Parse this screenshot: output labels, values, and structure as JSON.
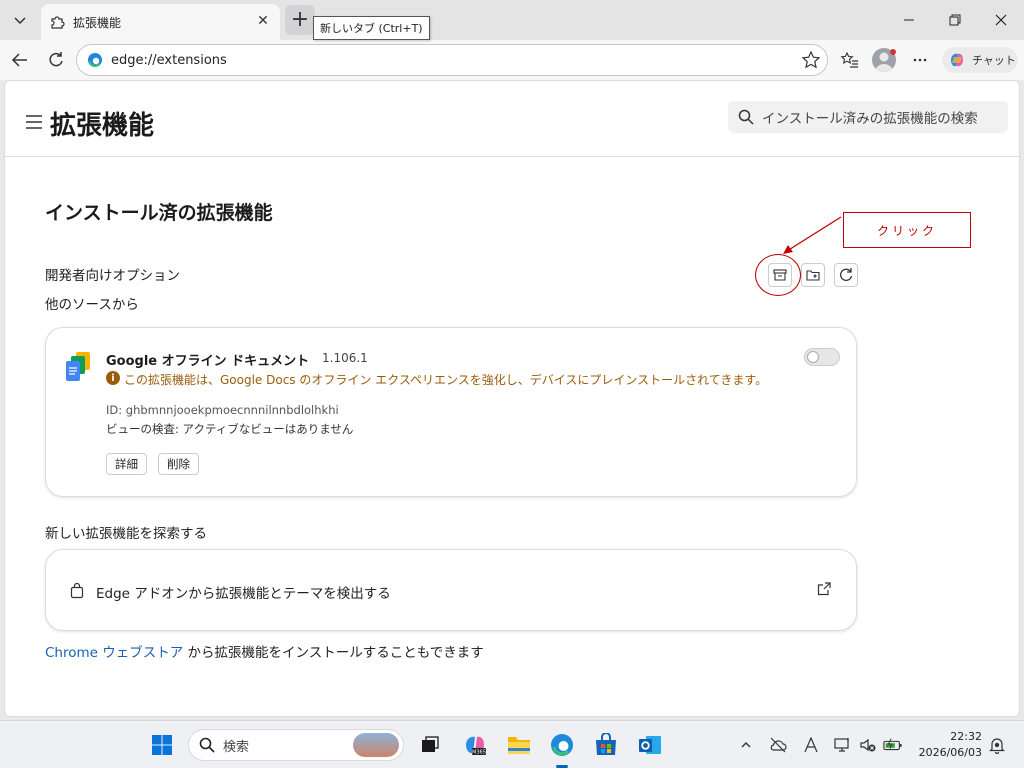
{
  "browser": {
    "tab_title": "拡張機能",
    "tab_close": "✕",
    "new_tab_tooltip": "新しいタブ (Ctrl+T)",
    "address": "edge://extensions",
    "chat_label": "チャット"
  },
  "page": {
    "title": "拡張機能",
    "search_placeholder": "インストール済みの拡張機能の検索",
    "section_title": "インストール済の拡張機能",
    "dev_options": "開発者向けオプション",
    "other_sources": "他のソースから",
    "annotation": "クリック"
  },
  "extension": {
    "name": "Google オフライン ドキュメント",
    "version": "1.106.1",
    "warning": "この拡張機能は、Google Docs のオフライン エクスペリエンスを強化し、デバイスにプレインストールされてきます。",
    "id": "ID: ghbmnnjooekpmoecnnnilnnbdlolhkhi",
    "inspect": "ビューの検査: アクティブなビューはありません",
    "details_label": "詳細",
    "remove_label": "削除",
    "enabled": false
  },
  "find": {
    "title": "新しい拡張機能を探索する",
    "addons_label": "Edge アドオンから拡張機能とテーマを検出する"
  },
  "store_line": {
    "link_chrome": "Chrome",
    "link_store": "ウェブストア",
    "rest": " から拡張機能をインストールすることもできます"
  },
  "taskbar": {
    "search_label": "検索",
    "time": "22:32",
    "date": "2026/06/03"
  },
  "colors": {
    "accent": "#0067c0",
    "annotation": "#c00000",
    "warning": "#9b5c0a",
    "link": "#1a5fb4"
  }
}
